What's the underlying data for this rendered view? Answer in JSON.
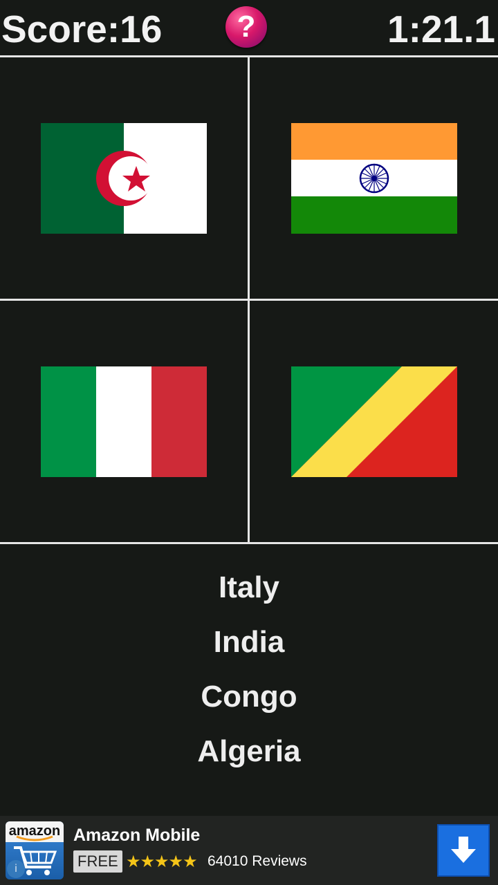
{
  "header": {
    "score_text": "Score:16",
    "timer_text": "1:21.1",
    "help_label": "?"
  },
  "flags": [
    {
      "country": "Algeria",
      "icon": "algeria-flag-icon"
    },
    {
      "country": "India",
      "icon": "india-flag-icon"
    },
    {
      "country": "Italy",
      "icon": "italy-flag-icon"
    },
    {
      "country": "Congo",
      "icon": "congo-flag-icon"
    }
  ],
  "answers": [
    "Italy",
    "India",
    "Congo",
    "Algeria"
  ],
  "ad": {
    "logo_text": "amazon",
    "title": "Amazon Mobile",
    "badge": "FREE",
    "stars": "★★★★★",
    "rating": 4.5,
    "reviews": "64010 Reviews",
    "info_label": "i"
  },
  "colors": {
    "background": "#161916",
    "divider": "#e6e6e6",
    "help_button": "#d8186a",
    "download_button": "#1a6fe0"
  }
}
